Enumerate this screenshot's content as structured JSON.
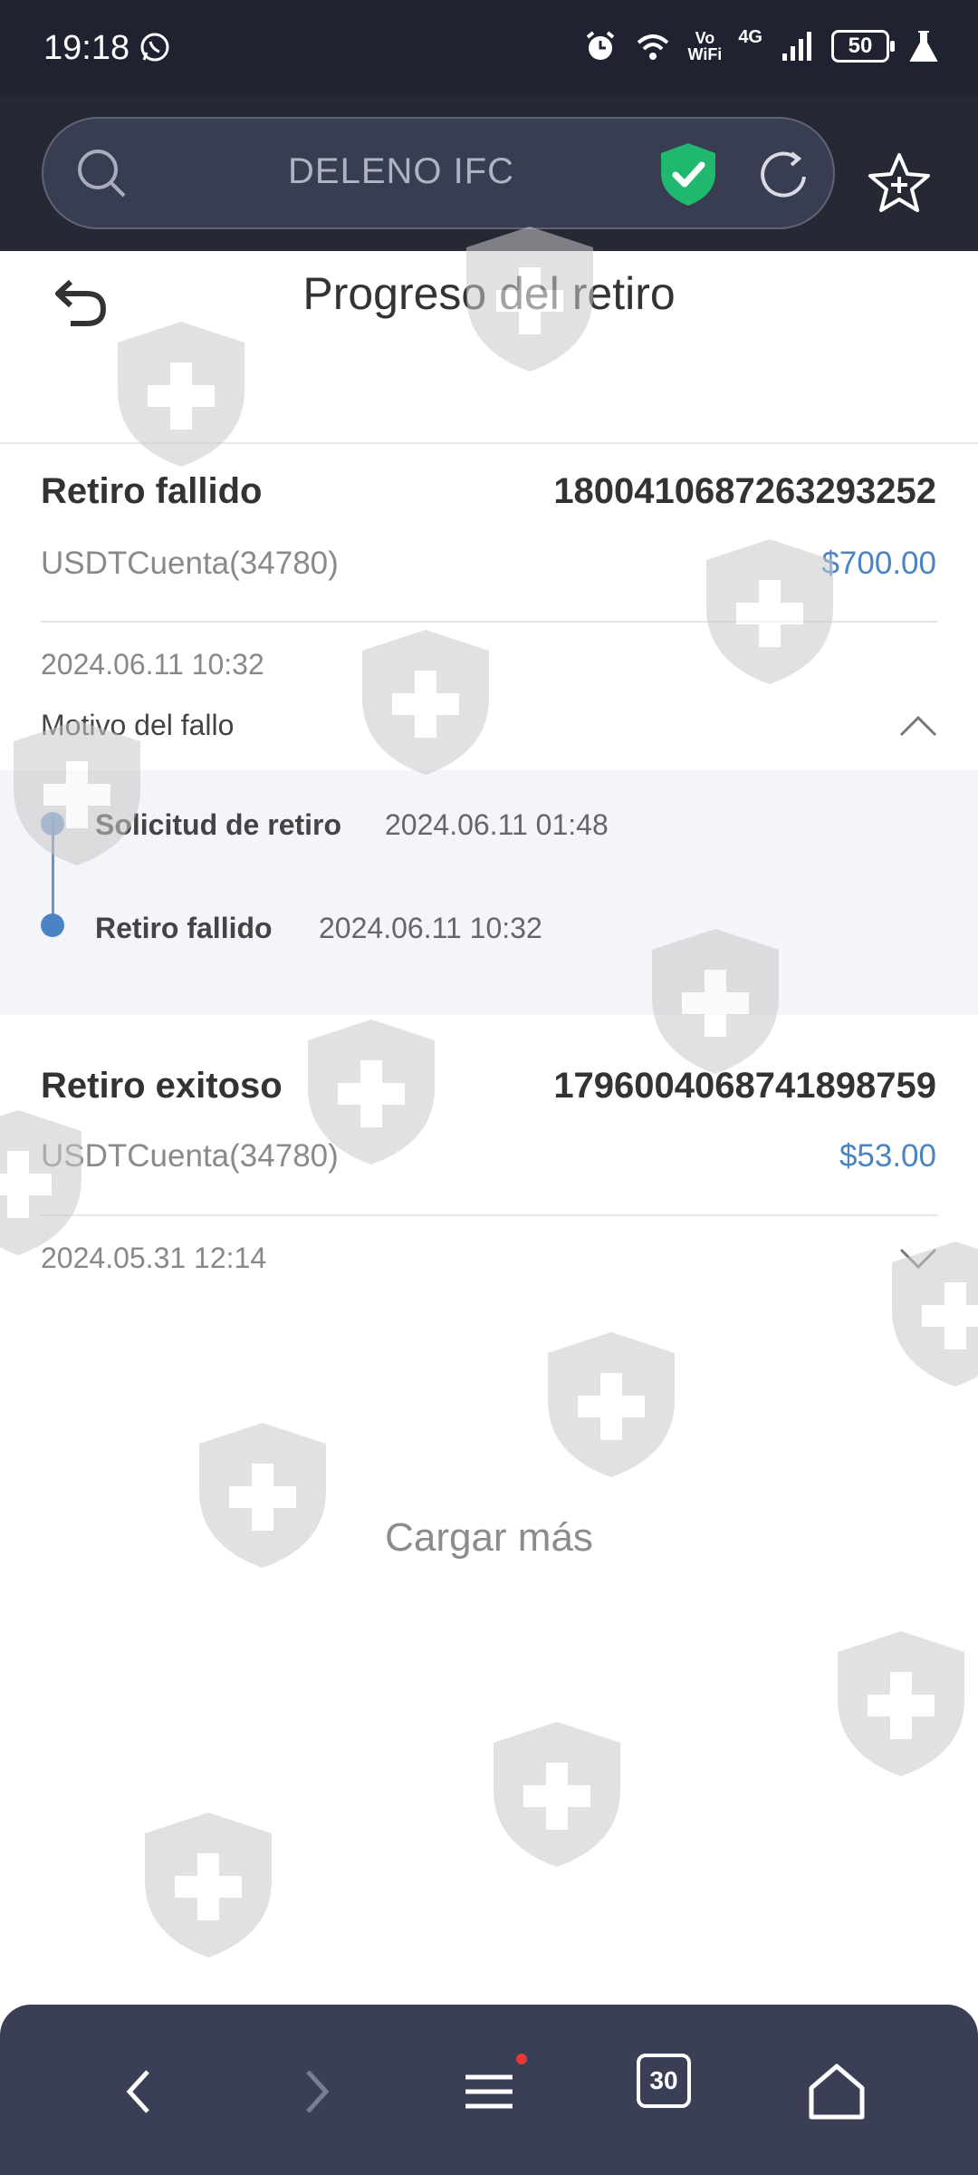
{
  "status_bar": {
    "time": "19:18",
    "volte_top": "Vo",
    "volte_bottom": "WiFi",
    "network": "4G",
    "battery": "50"
  },
  "browser": {
    "url_text": "DELENO IFC"
  },
  "page": {
    "title": "Progreso del retiro"
  },
  "records": [
    {
      "status": "Retiro fallido",
      "id": "1800410687263293252",
      "account": "USDTCuenta(34780)",
      "amount": "$700.00",
      "date": "2024.06.11 10:32",
      "reason_label": "Motivo del fallo",
      "timeline": [
        {
          "label": "Solicitud de retiro",
          "time": "2024.06.11 01:48"
        },
        {
          "label": "Retiro fallido",
          "time": "2024.06.11 10:32"
        }
      ]
    },
    {
      "status": "Retiro exitoso",
      "id": "1796004068741898759",
      "account": "USDTCuenta(34780)",
      "amount": "$53.00",
      "date": "2024.05.31 12:14"
    }
  ],
  "load_more": "Cargar más",
  "nav": {
    "tabs_count": "30"
  },
  "colors": {
    "accent": "#4a84c4",
    "status_bar": "#1f2230",
    "nav_bar": "#3b3f55",
    "shield_green": "#1fb86e"
  },
  "icons": [
    "search-icon",
    "shield-check-icon",
    "reload-icon",
    "star-add-icon",
    "back-icon",
    "chevron-up-icon",
    "chevron-down-icon",
    "nav-back-icon",
    "nav-forward-icon",
    "menu-icon",
    "tabs-icon",
    "home-icon"
  ]
}
